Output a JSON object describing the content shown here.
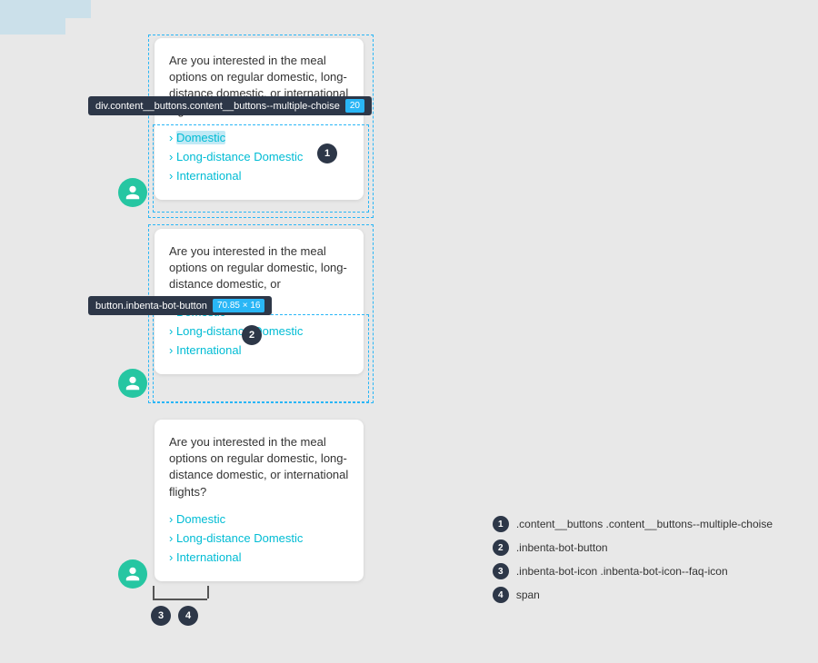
{
  "cards": [
    {
      "id": "card-1",
      "question": "Are you interested in the meal options on regular domestic, long-distance domestic, or international flights?",
      "options": [
        "Domestic",
        "Long-distance Domestic",
        "International"
      ]
    },
    {
      "id": "card-2",
      "question": "Are you interested in the meal options on regular domestic, long-distance domestic, or",
      "options": [
        "Domestic",
        "Long-distance Domestic",
        "International"
      ]
    },
    {
      "id": "card-3",
      "question": "Are you interested in the meal options on regular domestic, long-distance domestic, or international flights?",
      "options": [
        "Domestic",
        "Long-distance Domestic",
        "International"
      ]
    }
  ],
  "tooltips": [
    {
      "id": "tooltip-1",
      "label": "div.content__buttons.content__buttons--multiple-choise",
      "dim": "20"
    },
    {
      "id": "tooltip-2",
      "label": "button.inbenta-bot-button",
      "dim": "70.85 × 16"
    }
  ],
  "legend": [
    {
      "number": "1",
      "text": ".content__buttons .content__buttons--multiple-choise"
    },
    {
      "number": "2",
      "text": ".inbenta-bot-button"
    },
    {
      "number": "3",
      "text": ".inbenta-bot-icon .inbenta-bot-icon--faq-icon"
    },
    {
      "number": "4",
      "text": "span"
    }
  ],
  "badges": {
    "1": "1",
    "2": "2",
    "3": "3",
    "4": "4"
  }
}
